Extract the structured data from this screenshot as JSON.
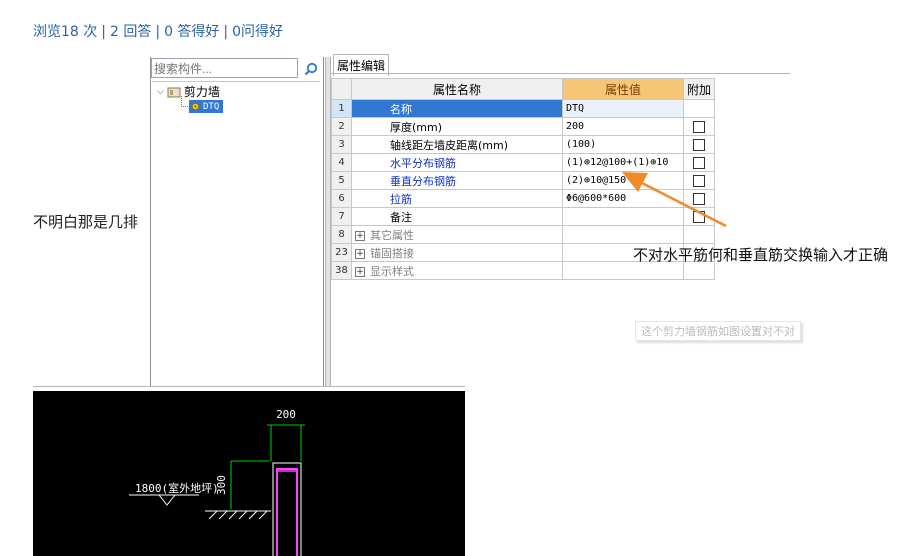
{
  "stats": {
    "views": "浏览18 次",
    "answers": "2 回答",
    "good_answers": "0 答得好",
    "good_questions": "0问得好",
    "separator": "|"
  },
  "tree": {
    "search_placeholder": "搜索构件...",
    "root_label": "剪力墙",
    "child_label": "DTQ"
  },
  "properties": {
    "tab_label": "属性编辑",
    "headers": {
      "name": "属性名称",
      "value": "属性值",
      "extra": "附加"
    },
    "rows": [
      {
        "num": "1",
        "name": "名称",
        "value": "DTQ",
        "checkbox": false,
        "selected": true,
        "style": "normal"
      },
      {
        "num": "2",
        "name": "厚度(mm)",
        "value": "200",
        "checkbox": true,
        "style": "normal"
      },
      {
        "num": "3",
        "name": "轴线距左墙皮距离(mm)",
        "value": "(100)",
        "checkbox": true,
        "style": "normal"
      },
      {
        "num": "4",
        "name": "水平分布钢筋",
        "value": "(1)⊕12@100+(1)⊕10",
        "checkbox": true,
        "style": "blue"
      },
      {
        "num": "5",
        "name": "垂直分布钢筋",
        "value": "(2)⊕10@150",
        "checkbox": true,
        "style": "blue"
      },
      {
        "num": "6",
        "name": "拉筋",
        "value": "Φ6@600*600",
        "checkbox": true,
        "style": "blue"
      },
      {
        "num": "7",
        "name": "备注",
        "value": "",
        "checkbox": true,
        "style": "normal"
      },
      {
        "num": "8",
        "name": "其它属性",
        "value": "",
        "checkbox": false,
        "style": "group"
      },
      {
        "num": "23",
        "name": "锚固搭接",
        "value": "",
        "checkbox": false,
        "style": "group"
      },
      {
        "num": "38",
        "name": "显示样式",
        "value": "",
        "checkbox": false,
        "style": "group"
      }
    ],
    "expand_symbol": "+"
  },
  "annotations": {
    "left_note": "不明白那是几排",
    "right_note": "不对水平筋何和垂直筋交换输入才正确",
    "tooltip": "这个剪力墙钢筋如图设置对不对"
  },
  "cad": {
    "width_dim": "200",
    "height_dim": "300",
    "level_text": "1800(室外地坪)"
  },
  "colors": {
    "link_blue": "#2a64a8",
    "selection_blue": "#3278d2",
    "value_header_orange": "#f6c677",
    "arrow_orange": "#f08a2a",
    "cad_background": "#000000",
    "cad_green": "#00d000",
    "cad_magenta": "#ff40ff"
  }
}
